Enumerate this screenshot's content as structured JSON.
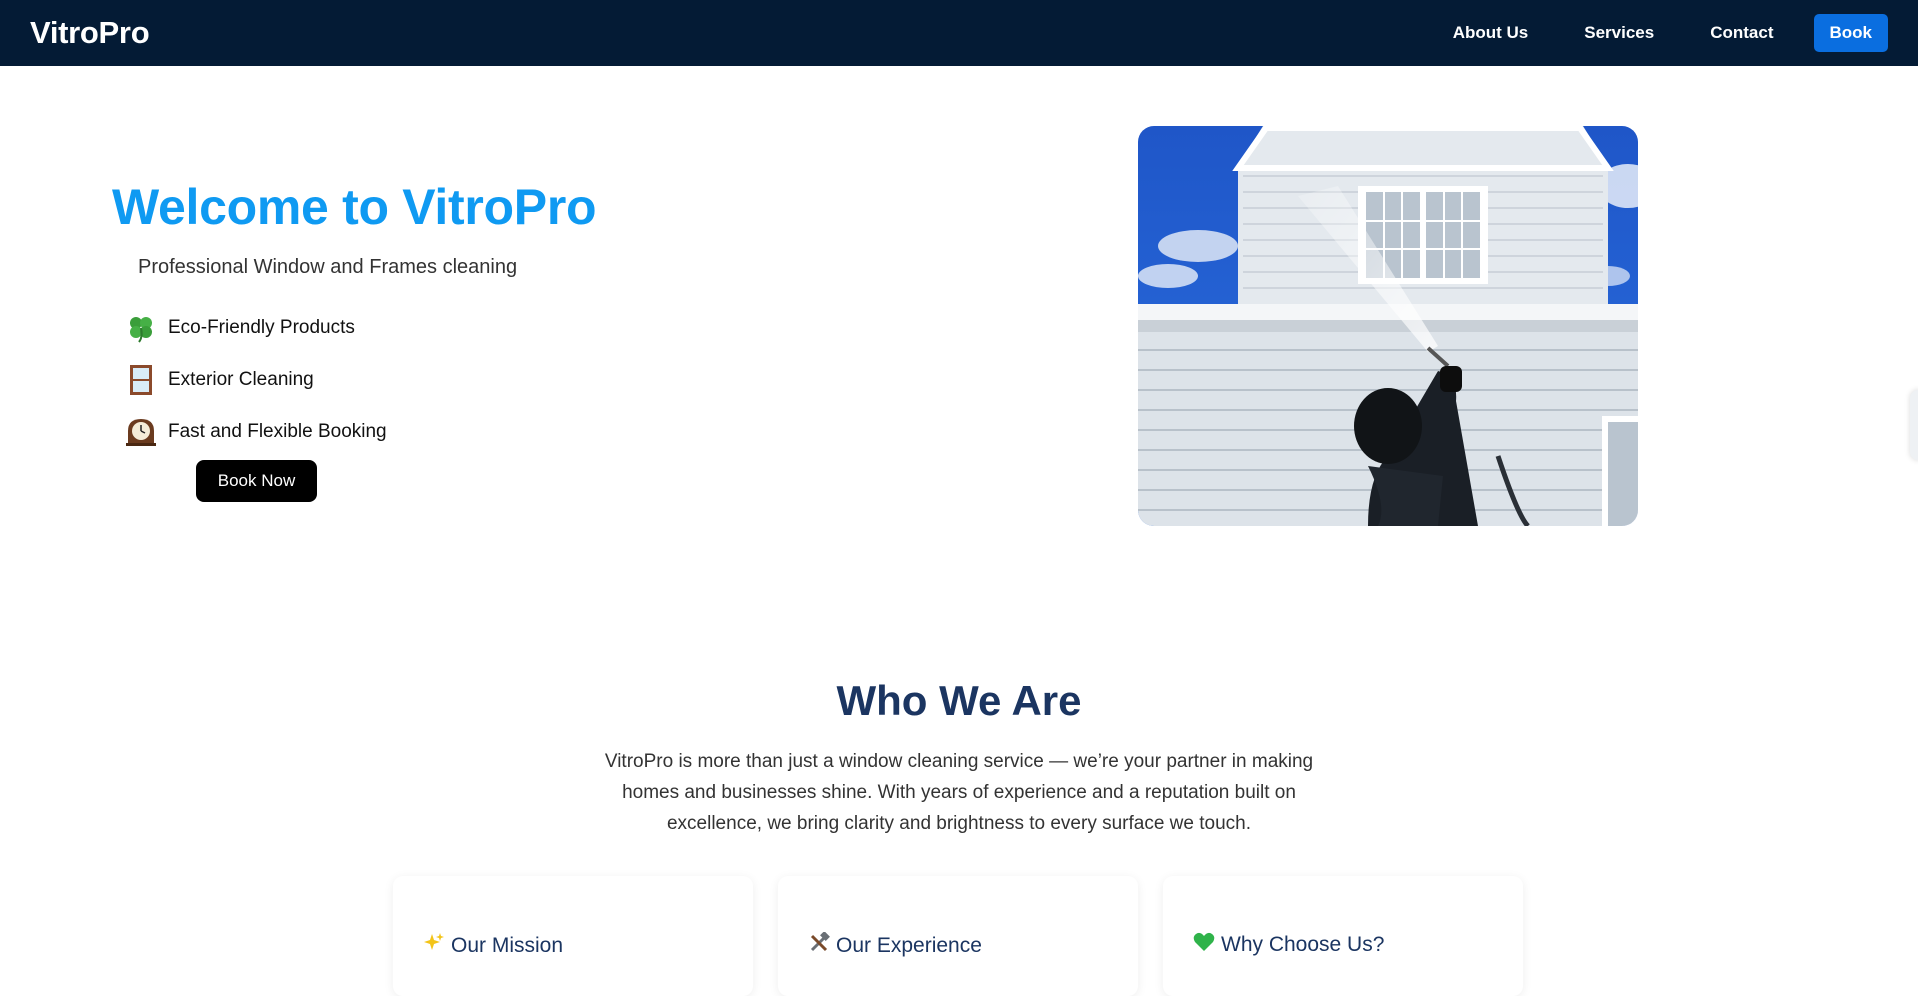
{
  "header": {
    "brand": "VitroPro",
    "nav": [
      {
        "label": "About Us"
      },
      {
        "label": "Services"
      },
      {
        "label": "Contact"
      }
    ],
    "book_label": "Book"
  },
  "hero": {
    "title": "Welcome to VitroPro",
    "subtitle": "Professional Window and Frames cleaning",
    "features": [
      {
        "icon": "clover-icon",
        "label": "Eco-Friendly Products"
      },
      {
        "icon": "door-icon",
        "label": "Exterior Cleaning"
      },
      {
        "icon": "clock-icon",
        "label": "Fast and Flexible Booking"
      }
    ],
    "cta_label": "Book Now",
    "image_icon": "house-pressure-washing-photo"
  },
  "about": {
    "title": "Who We Are",
    "text": "VitroPro is more than just a window cleaning service — we’re your partner in making homes and businesses shine. With years of experience and a reputation built on excellence, we bring clarity and brightness to every surface we touch.",
    "cards": [
      {
        "icon": "sparkles-icon",
        "title": "Our Mission"
      },
      {
        "icon": "tools-icon",
        "title": "Our Experience"
      },
      {
        "icon": "green-heart-icon",
        "title": "Why Choose Us?"
      }
    ]
  },
  "colors": {
    "navbar": "#041b35",
    "accent": "#0f9af2",
    "book_button": "#0a6ee0",
    "heading": "#1b3561"
  }
}
